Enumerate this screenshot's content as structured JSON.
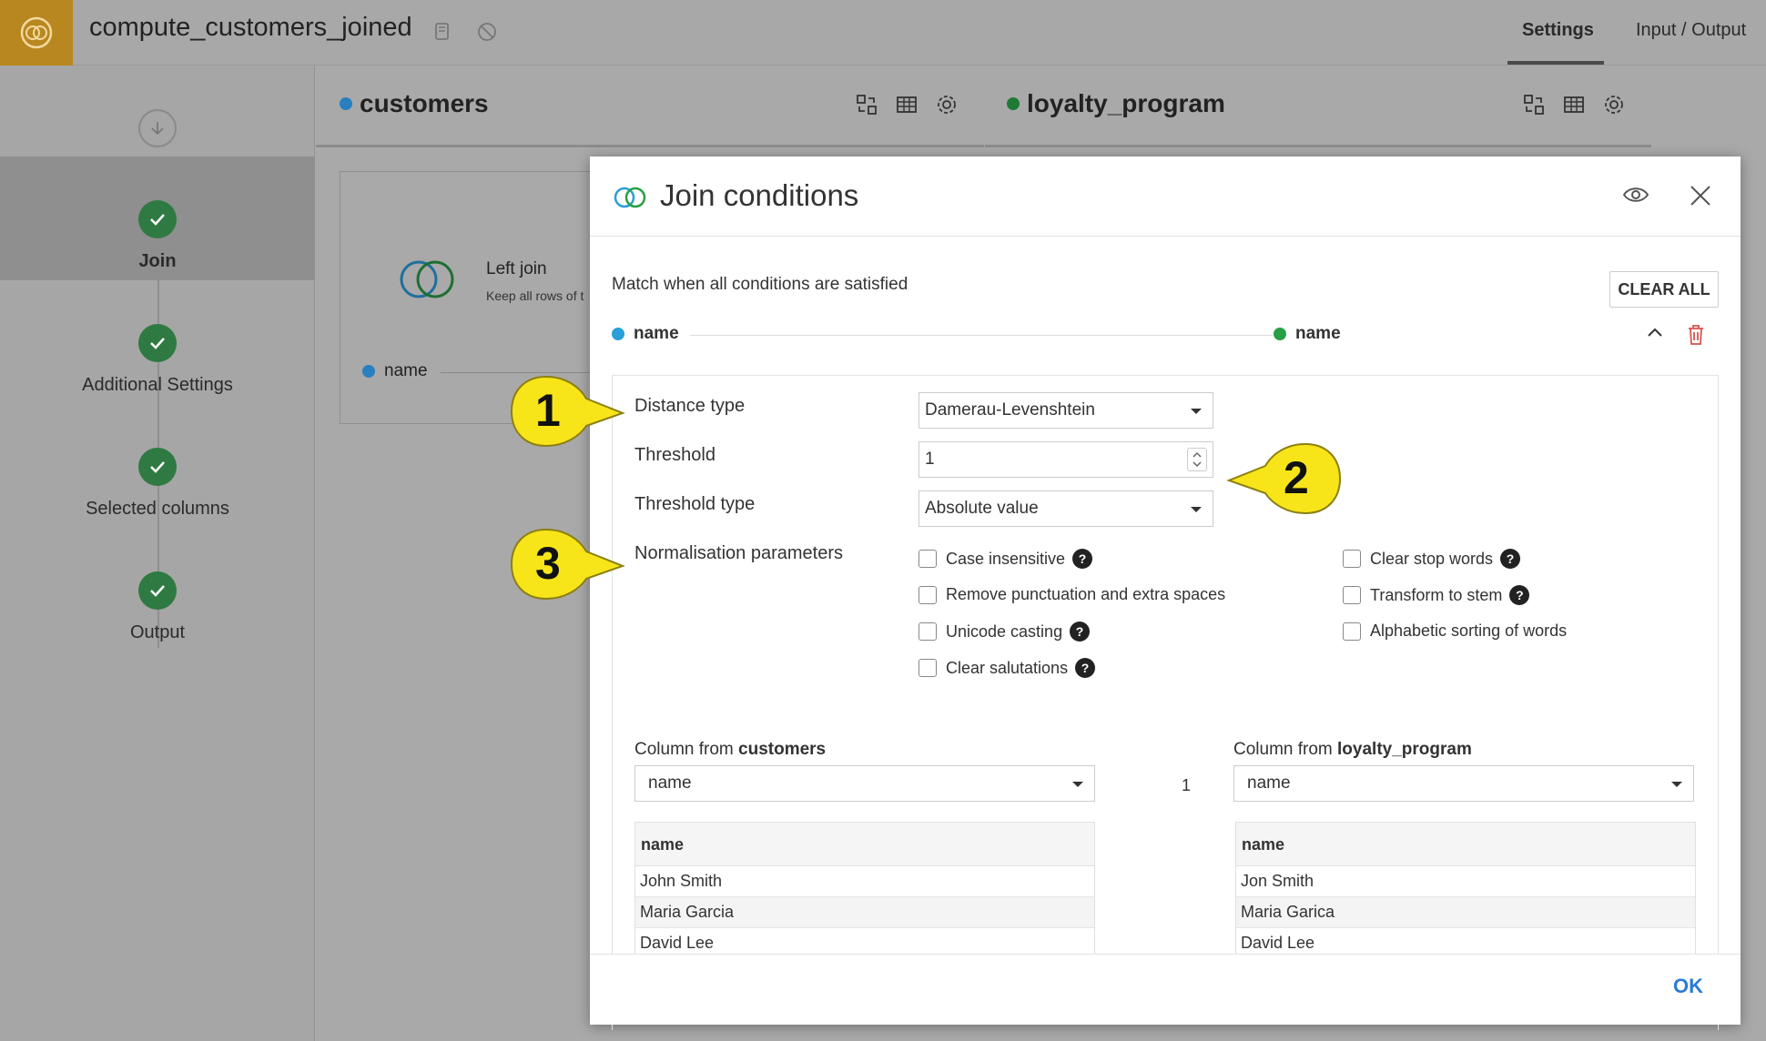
{
  "header": {
    "recipe_title": "compute_customers_joined",
    "tabs": [
      {
        "label": "Settings",
        "active": true
      },
      {
        "label": "Input / Output",
        "active": false
      }
    ]
  },
  "nav": {
    "steps": [
      {
        "label": "Join",
        "active": true
      },
      {
        "label": "Additional Settings",
        "active": false
      },
      {
        "label": "Selected columns",
        "active": false
      },
      {
        "label": "Output",
        "active": false
      }
    ]
  },
  "datasets": {
    "left": {
      "name": "customers",
      "color": "#2a8fd6"
    },
    "right": {
      "name": "loyalty_program",
      "color": "#27a045"
    }
  },
  "join_card": {
    "title": "Left join",
    "subtitle": "Keep all rows of t",
    "column": "name"
  },
  "modal": {
    "title": "Join conditions",
    "match_text": "Match when all conditions are satisfied",
    "clear_all": "CLEAR ALL",
    "condition": {
      "left_col": "name",
      "right_col": "name"
    },
    "form": {
      "distance_type_label": "Distance type",
      "distance_type_value": "Damerau-Levenshtein",
      "threshold_label": "Threshold",
      "threshold_value": "1",
      "threshold_type_label": "Threshold type",
      "threshold_type_value": "Absolute value",
      "normalisation_label": "Normalisation parameters"
    },
    "normalisation_options": [
      {
        "label": "Case insensitive",
        "help": true,
        "checked": false
      },
      {
        "label": "Remove punctuation and extra spaces",
        "help": false,
        "checked": false
      },
      {
        "label": "Unicode casting",
        "help": true,
        "checked": false
      },
      {
        "label": "Clear salutations",
        "help": true,
        "checked": false
      },
      {
        "label": "Clear stop words",
        "help": true,
        "checked": false
      },
      {
        "label": "Transform to stem",
        "help": true,
        "checked": false
      },
      {
        "label": "Alphabetic sorting of words",
        "help": false,
        "checked": false
      }
    ],
    "help_glyph": "?",
    "column_from_prefix": "Column from",
    "left_column_value": "name",
    "right_column_value": "name",
    "match_count": "1",
    "left_preview": {
      "header": "name",
      "rows": [
        "John Smith",
        "Maria Garcia",
        "David Lee"
      ]
    },
    "right_preview": {
      "header": "name",
      "rows": [
        "Jon Smith",
        "Maria Garica",
        "David Lee"
      ]
    },
    "ok_label": "OK"
  },
  "callouts": [
    "1",
    "2",
    "3"
  ],
  "colors": {
    "callout_fill": "#f7e51a",
    "ok_blue": "#2b7bd6",
    "check_green": "#2f7a42",
    "delete_red": "#d9534f"
  }
}
